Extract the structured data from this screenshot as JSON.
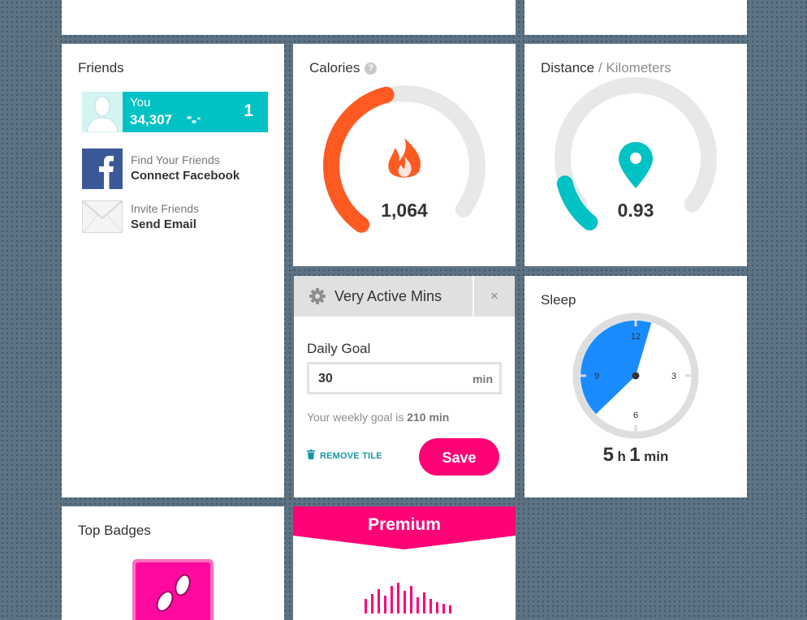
{
  "friends": {
    "title": "Friends",
    "you": {
      "name": "You",
      "steps": "34,307",
      "rank": "1"
    },
    "links": [
      {
        "line1": "Find Your Friends",
        "line2": "Connect Facebook"
      },
      {
        "line1": "Invite Friends",
        "line2": "Send Email"
      }
    ]
  },
  "calories": {
    "title": "Calories",
    "help": "?",
    "value": "1,064",
    "progress": 0.45,
    "color": "#fe5a22"
  },
  "distance": {
    "title": "Distance",
    "separator": " / ",
    "unit_label": "Kilometers",
    "value": "0.93",
    "progress": 0.13,
    "color": "#00c1c4"
  },
  "active_mins": {
    "title": "Very Active Mins",
    "close": "×",
    "goal_label": "Daily Goal",
    "goal_value": "30",
    "goal_unit": "min",
    "weekly_prefix": "Your weekly goal is ",
    "weekly_value": "210 min",
    "remove_label": "REMOVE TILE",
    "save_label": "Save"
  },
  "sleep": {
    "title": "Sleep",
    "hours": "5",
    "hours_unit": "h",
    "minutes": "1",
    "minutes_unit": "min",
    "clock_labels": [
      "12",
      "3",
      "6",
      "9"
    ],
    "color": "#1a8cff"
  },
  "badges": {
    "title": "Top Badges"
  },
  "premium": {
    "label": "Premium",
    "color": "#fe0276"
  }
}
